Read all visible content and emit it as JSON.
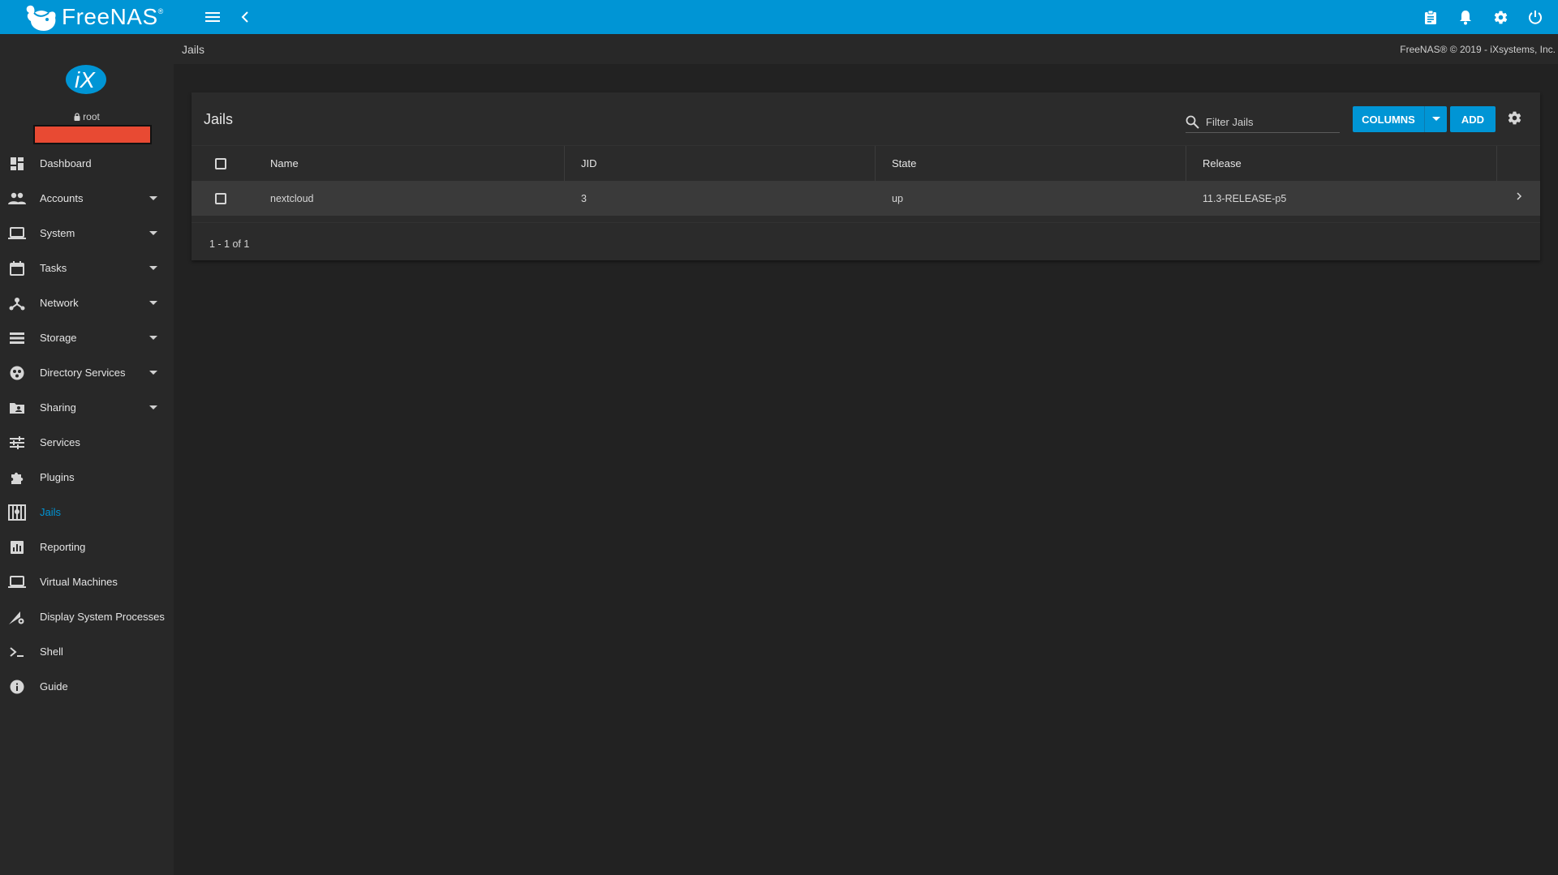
{
  "app": {
    "name": "FreeNAS",
    "trademark": "®",
    "brand_color": "#0095d5"
  },
  "topbar": {
    "icons": [
      "menu-icon",
      "chevron-left-icon",
      "clipboard-icon",
      "bell-icon",
      "gear-icon",
      "power-icon"
    ]
  },
  "profile": {
    "logo_text": "iX",
    "username": "root",
    "hostname_redacted_color": "#e84a33"
  },
  "sidebar": {
    "active_color": "#0095d5",
    "items": [
      {
        "label": "Dashboard",
        "icon": "dashboard-icon",
        "expandable": false
      },
      {
        "label": "Accounts",
        "icon": "people-icon",
        "expandable": true
      },
      {
        "label": "System",
        "icon": "laptop-icon",
        "expandable": true
      },
      {
        "label": "Tasks",
        "icon": "calendar-icon",
        "expandable": true
      },
      {
        "label": "Network",
        "icon": "network-icon",
        "expandable": true
      },
      {
        "label": "Storage",
        "icon": "storage-icon",
        "expandable": true
      },
      {
        "label": "Directory Services",
        "icon": "directory-icon",
        "expandable": true
      },
      {
        "label": "Sharing",
        "icon": "folder-shared-icon",
        "expandable": true
      },
      {
        "label": "Services",
        "icon": "tune-icon",
        "expandable": false
      },
      {
        "label": "Plugins",
        "icon": "puzzle-icon",
        "expandable": false
      },
      {
        "label": "Jails",
        "icon": "jail-icon",
        "expandable": false,
        "active": true
      },
      {
        "label": "Reporting",
        "icon": "chart-icon",
        "expandable": false
      },
      {
        "label": "Virtual Machines",
        "icon": "monitor-icon",
        "expandable": false
      },
      {
        "label": "Display System Processes",
        "icon": "processes-icon",
        "expandable": false
      },
      {
        "label": "Shell",
        "icon": "terminal-icon",
        "expandable": false
      },
      {
        "label": "Guide",
        "icon": "info-icon",
        "expandable": false
      }
    ]
  },
  "header": {
    "breadcrumb": "Jails",
    "copyright": "FreeNAS® © 2019 - iXsystems, Inc."
  },
  "card": {
    "title": "Jails",
    "search_placeholder": "Filter Jails",
    "columns_label": "COLUMNS",
    "add_label": "ADD",
    "table": {
      "columns": [
        "Name",
        "JID",
        "State",
        "Release"
      ],
      "rows": [
        {
          "name": "nextcloud",
          "jid": "3",
          "state": "up",
          "release": "11.3-RELEASE-p5"
        }
      ]
    },
    "pagination": "1 - 1 of 1"
  }
}
